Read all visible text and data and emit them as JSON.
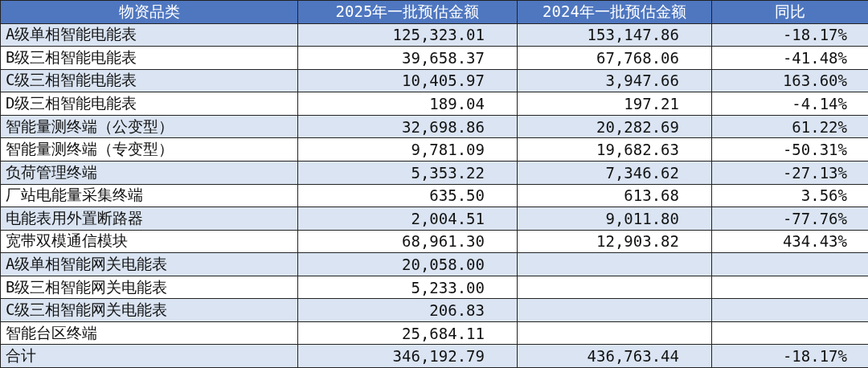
{
  "table": {
    "columns": [
      "物资品类",
      "2025年一批预估金额",
      "2024年一批预估金额",
      "同比"
    ],
    "rows": [
      {
        "cells": [
          "A级单相智能电能表",
          "125,323.01",
          "153,147.86",
          "-18.17%"
        ]
      },
      {
        "cells": [
          "B级三相智能电能表",
          "39,658.37",
          "67,768.06",
          "-41.48%"
        ]
      },
      {
        "cells": [
          "C级三相智能电能表",
          "10,405.97",
          "3,947.66",
          "163.60%"
        ]
      },
      {
        "cells": [
          "D级三相智能电能表",
          "189.04",
          "197.21",
          "-4.14%"
        ]
      },
      {
        "cells": [
          "智能量测终端（公变型）",
          "32,698.86",
          "20,282.69",
          "61.22%"
        ]
      },
      {
        "cells": [
          "智能量测终端（专变型）",
          "9,781.09",
          "19,682.63",
          "-50.31%"
        ]
      },
      {
        "cells": [
          "负荷管理终端",
          "5,353.22",
          "7,346.62",
          "-27.13%"
        ]
      },
      {
        "cells": [
          "厂站电能量采集终端",
          "635.50",
          "613.68",
          "3.56%"
        ]
      },
      {
        "cells": [
          "电能表用外置断路器",
          "2,004.51",
          "9,011.80",
          "-77.76%"
        ]
      },
      {
        "cells": [
          "宽带双模通信模块",
          "68,961.30",
          "12,903.82",
          "434.43%"
        ]
      },
      {
        "cells": [
          "A级单相智能网关电能表",
          "20,058.00"
        ]
      },
      {
        "cells": [
          "B级三相智能网关电能表",
          "5,233.00"
        ]
      },
      {
        "cells": [
          "C级三相智能网关电能表",
          "206.83"
        ]
      },
      {
        "cells": [
          "智能台区终端",
          "25,684.11"
        ]
      },
      {
        "cells": [
          "合计",
          "346,192.79",
          "436,763.44",
          "-18.17%"
        ]
      }
    ]
  }
}
